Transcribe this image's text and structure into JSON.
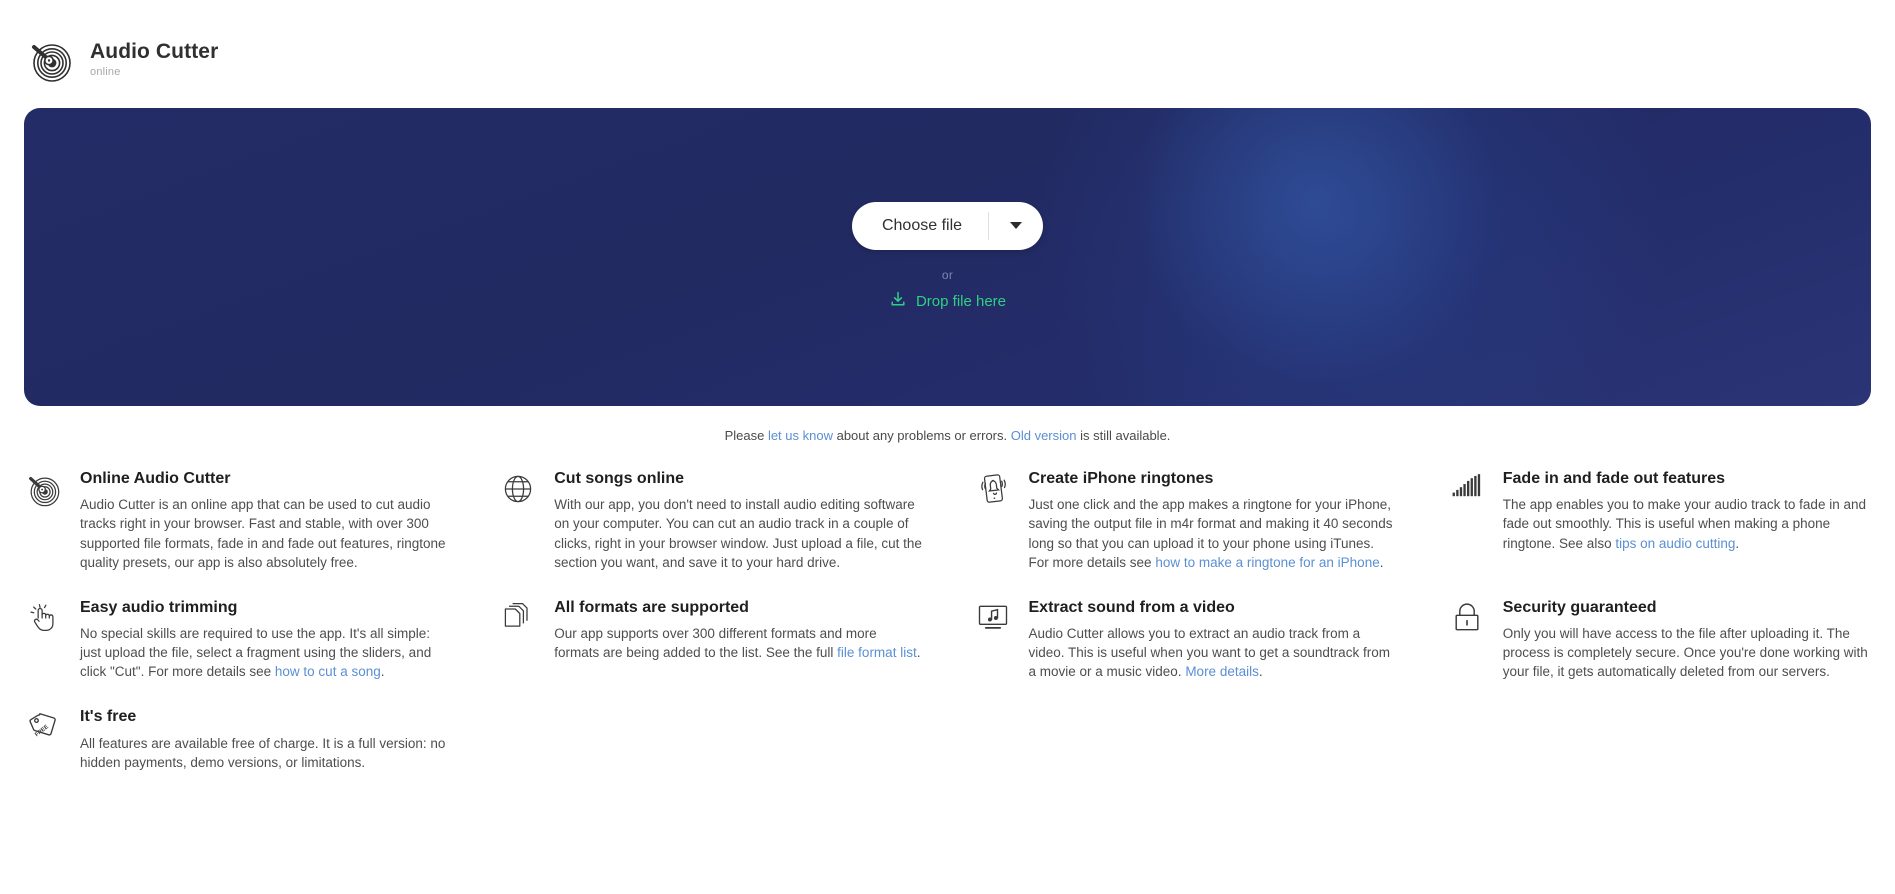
{
  "header": {
    "logo_icon": "vinyl-record-icon",
    "title": "Audio Cutter",
    "subtitle": "online"
  },
  "hero": {
    "choose_file_label": "Choose file",
    "dropdown_icon": "chevron-down-icon",
    "or_label": "or",
    "drop_icon": "download-icon",
    "drop_file_label": "Drop file here",
    "background_color": "#232c66",
    "glow_color": "#365caa",
    "drop_link_color": "#2fcf83"
  },
  "notice": {
    "before_link": "Please ",
    "link1": "let us know",
    "middle": " about any problems or errors. ",
    "link2": "Old version",
    "after_link": " is still available."
  },
  "link_color": "#5b8fd4",
  "features": [
    {
      "icon": "vinyl-record-icon",
      "title": "Online Audio Cutter",
      "text": "Audio Cutter is an online app that can be used to cut audio tracks right in your browser. Fast and stable, with over 300 supported file formats, fade in and fade out features, ringtone quality presets, our app is also absolutely free.",
      "link": "",
      "text_after_link": ""
    },
    {
      "icon": "globe-icon",
      "title": "Cut songs online",
      "text": "With our app, you don't need to install audio editing software on your computer. You can cut an audio track in a couple of clicks, right in your browser window. Just upload a file, cut the section you want, and save it to your hard drive.",
      "link": "",
      "text_after_link": ""
    },
    {
      "icon": "phone-ringtone-icon",
      "title": "Create iPhone ringtones",
      "text": "Just one click and the app makes a ringtone for your iPhone, saving the output file in m4r format and making it 40 seconds long so that you can upload it to your phone using iTunes. For more details see ",
      "link": "how to make a ringtone for an iPhone",
      "text_after_link": "."
    },
    {
      "icon": "fade-bars-icon",
      "title": "Fade in and fade out features",
      "text": "The app enables you to make your audio track to fade in and fade out smoothly. This is useful when making a phone ringtone. See also ",
      "link": "tips on audio cutting",
      "text_after_link": "."
    },
    {
      "icon": "pointing-hand-icon",
      "title": "Easy audio trimming",
      "text": "No special skills are required to use the app. It's all simple: just upload the file, select a fragment using the sliders, and click \"Cut\". For more details see ",
      "link": "how to cut a song",
      "text_after_link": "."
    },
    {
      "icon": "documents-stack-icon",
      "title": "All formats are supported",
      "text": "Our app supports over 300 different formats and more formats are being added to the list. See the full ",
      "link": "file format list",
      "text_after_link": "."
    },
    {
      "icon": "monitor-music-icon",
      "title": "Extract sound from a video",
      "text": "Audio Cutter allows you to extract an audio track from a video. This is useful when you want to get a soundtrack from a movie or a music video. ",
      "link": "More details",
      "text_after_link": "."
    },
    {
      "icon": "padlock-icon",
      "title": "Security guaranteed",
      "text": "Only you will have access to the file after uploading it. The process is completely secure. Once you're done working with your file, it gets automatically deleted from our servers.",
      "link": "",
      "text_after_link": ""
    },
    {
      "icon": "free-price-tag-icon",
      "title": "It's free",
      "text": "All features are available free of charge. It is a full version: no hidden payments, demo versions, or limitations.",
      "link": "",
      "text_after_link": ""
    }
  ]
}
